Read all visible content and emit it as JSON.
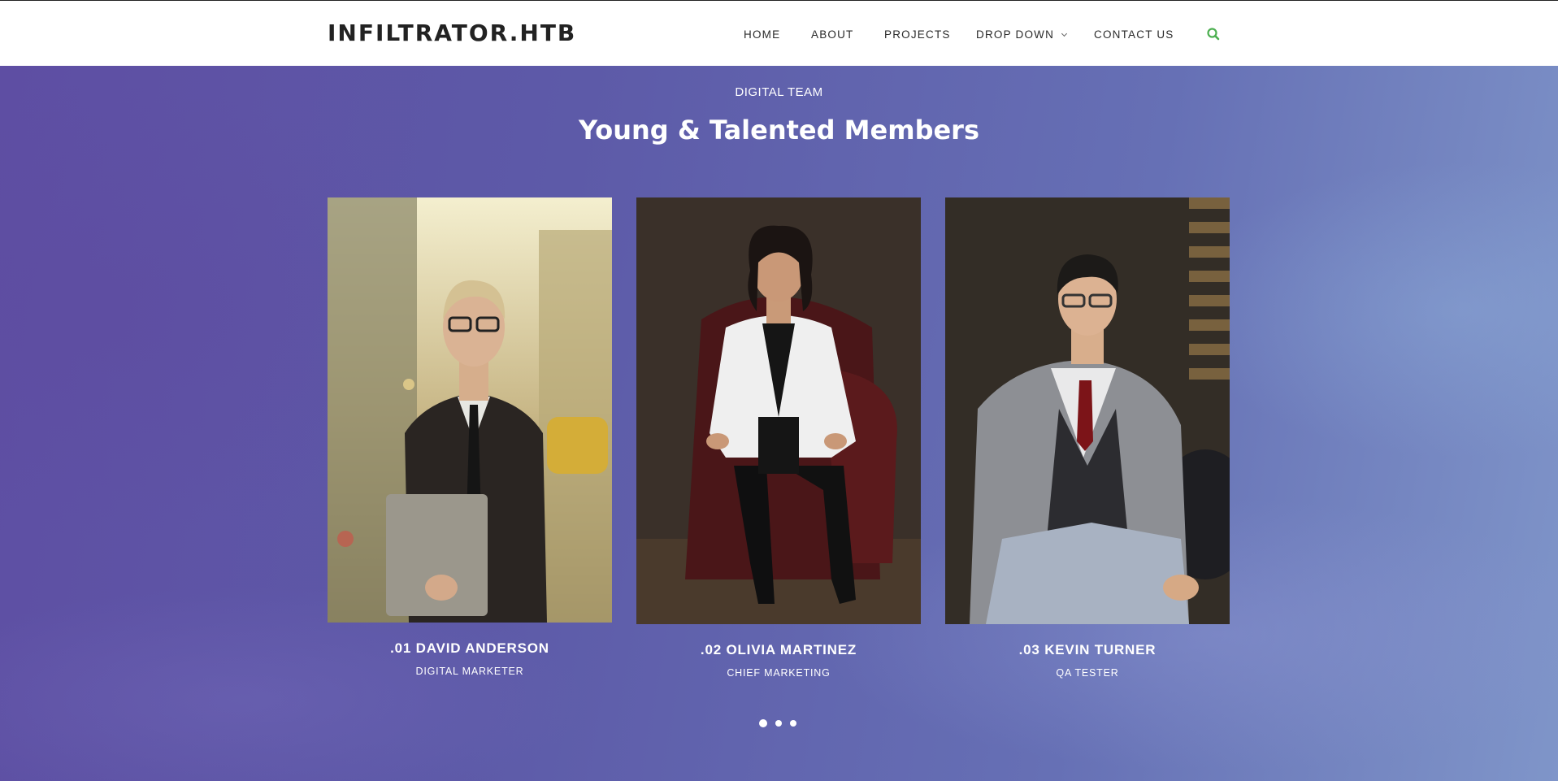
{
  "header": {
    "logo": "INFILTRATOR.HTB",
    "nav": [
      {
        "label": "HOME"
      },
      {
        "label": "ABOUT"
      },
      {
        "label": "PROJECTS"
      },
      {
        "label": "DROP DOWN"
      },
      {
        "label": "CONTACT US"
      }
    ],
    "search_icon": "search-icon",
    "accent_color": "#4caf50"
  },
  "team": {
    "eyebrow": "DIGITAL TEAM",
    "heading": "Young & Talented Members",
    "members": [
      {
        "name": ".01 DAVID ANDERSON",
        "role": "DIGITAL MARKETER"
      },
      {
        "name": ".02 OLIVIA MARTINEZ",
        "role": "CHIEF MARKETING"
      },
      {
        "name": ".03 KEVIN TURNER",
        "role": "QA TESTER"
      }
    ],
    "carousel": {
      "pages": 3,
      "active": 1
    }
  },
  "colors": {
    "header_bg": "#ffffff",
    "section_bg": "#5d5aa8",
    "text_light": "#ffffff"
  }
}
